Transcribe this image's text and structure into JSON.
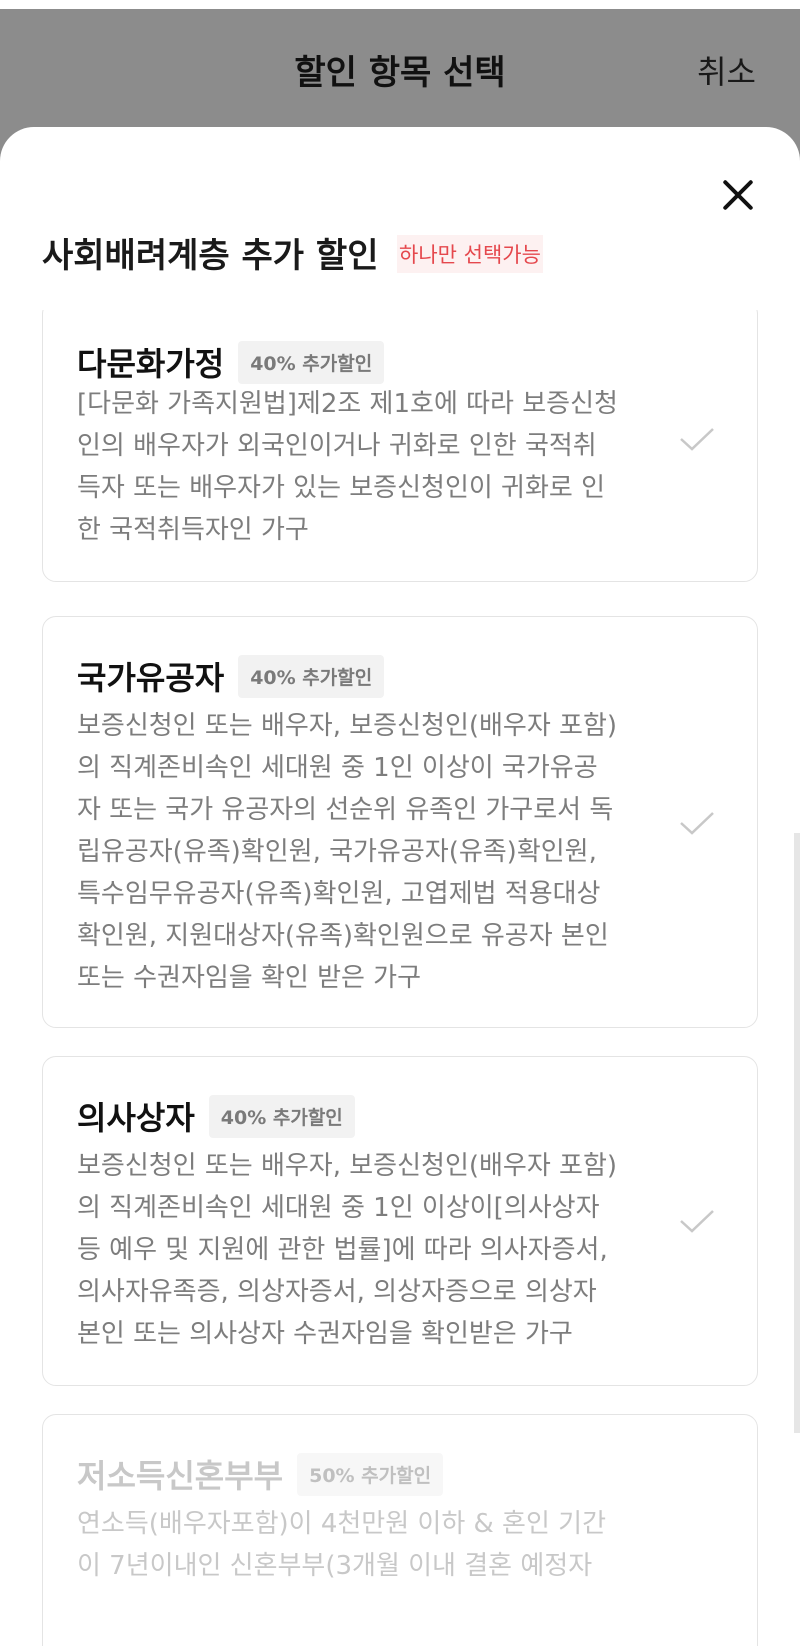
{
  "header": {
    "title": "할인 항목 선택",
    "cancel_label": "취소"
  },
  "sheet": {
    "title": "사회배려계층 추가 할인",
    "only_one_label": "하나만 선택가능",
    "items": [
      {
        "name": "다문화가정",
        "badge": "40% 추가할인",
        "lines": [
          "[다문화 가족지원법]제2조 제1호에 따라 보증신청",
          "인의 배우자가 외국인이거나 귀화로 인한 국적취",
          "득자 또는 배우자가 있는 보증신청인이 귀화로 인",
          "한 국적취득자인 가구"
        ]
      },
      {
        "name": "국가유공자",
        "badge": "40% 추가할인",
        "lines": [
          "보증신청인 또는 배우자, 보증신청인(배우자 포함)",
          "의 직계존비속인 세대원 중 1인 이상이 국가유공",
          "자 또는 국가 유공자의 선순위 유족인 가구로서 독",
          "립유공자(유족)확인원, 국가유공자(유족)확인원,",
          "특수임무유공자(유족)확인원, 고엽제법 적용대상",
          "확인원, 지원대상자(유족)확인원으로 유공자 본인",
          "또는 수권자임을 확인 받은 가구"
        ]
      },
      {
        "name": "의사상자",
        "badge": "40% 추가할인",
        "lines": [
          "보증신청인 또는 배우자, 보증신청인(배우자 포함)",
          "의 직계존비속인 세대원 중 1인 이상이[의사상자",
          "등 예우 및 지원에 관한 법률]에 따라 의사자증서,",
          "의사자유족증, 의상자증서, 의상자증으로 의상자",
          "본인 또는 의사상자 수권자임을 확인받은 가구"
        ]
      },
      {
        "name": "저소득신혼부부",
        "badge": "50% 추가할인",
        "lines": [
          "연소득(배우자포함)이 4천만원 이하 & 혼인 기간",
          "이 7년이내인 신혼부부(3개월 이내 결혼 예정자"
        ]
      }
    ]
  }
}
